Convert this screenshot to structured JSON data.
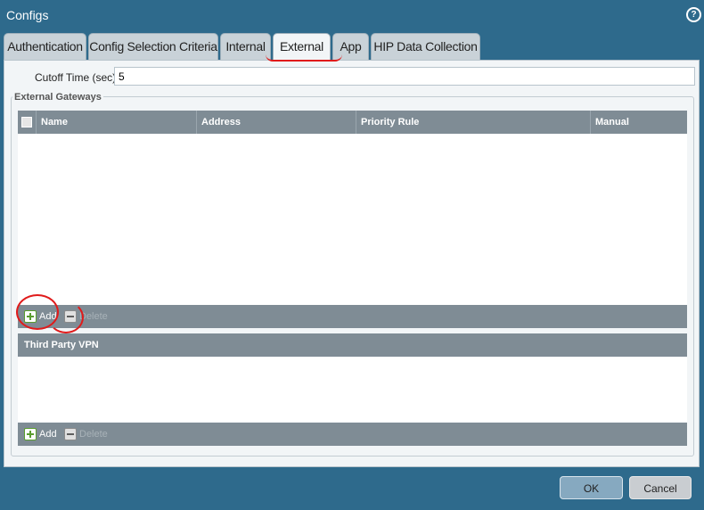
{
  "window": {
    "title": "Configs",
    "help_icon": "help-icon"
  },
  "tabs": [
    {
      "label": "Authentication",
      "active": false
    },
    {
      "label": "Config Selection Criteria",
      "active": false
    },
    {
      "label": "Internal",
      "active": false
    },
    {
      "label": "External",
      "active": true
    },
    {
      "label": "App",
      "active": false
    },
    {
      "label": "HIP Data Collection",
      "active": false
    }
  ],
  "cutoff": {
    "label": "Cutoff Time (sec)",
    "value": "5"
  },
  "external_gateways": {
    "legend": "External Gateways",
    "columns": [
      "Name",
      "Address",
      "Priority Rule",
      "Manual"
    ],
    "rows": [],
    "toolbar": {
      "add_label": "Add",
      "delete_label": "Delete"
    }
  },
  "third_party_vpn": {
    "header": "Third Party VPN",
    "rows": [],
    "toolbar": {
      "add_label": "Add",
      "delete_label": "Delete"
    }
  },
  "footer": {
    "ok_label": "OK",
    "cancel_label": "Cancel"
  },
  "colors": {
    "accent": "#2e6a8c",
    "annotation": "#e01b1b"
  }
}
